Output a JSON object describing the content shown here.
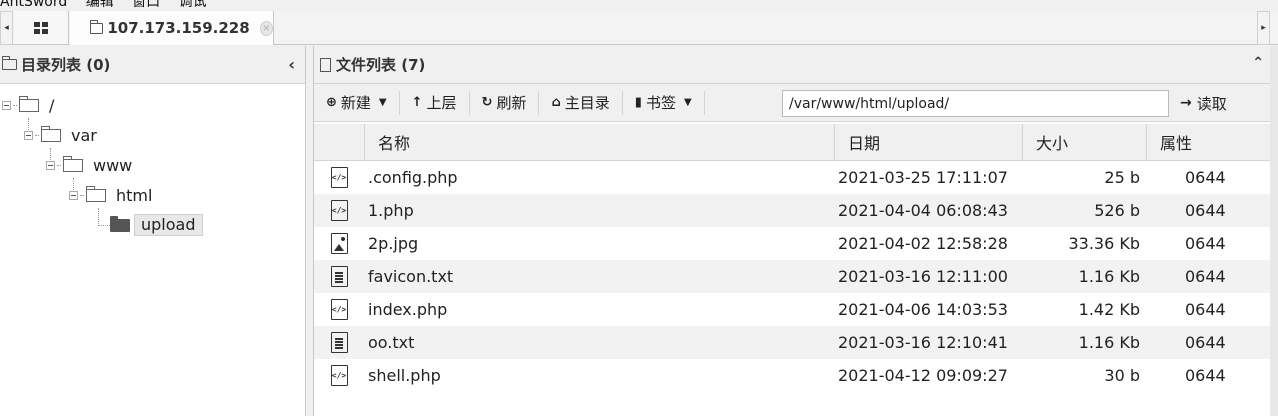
{
  "menubar": {
    "items": [
      "AntSword",
      "编辑",
      "窗口",
      "调试"
    ]
  },
  "tabs": {
    "home_icon": "grid-icon",
    "host_tab": {
      "label": "107.173.159.228",
      "icon": "folder-outline-icon",
      "close": "×"
    }
  },
  "left_panel": {
    "title": "目录列表 (0)",
    "collapse": "‹",
    "tree": {
      "root": "/",
      "var": "var",
      "www": "www",
      "html": "html",
      "upload": "upload"
    }
  },
  "right_panel": {
    "title": "文件列表 (7)",
    "expand": "⌃",
    "toolbar": {
      "new_label": "新建",
      "up_label": "上层",
      "refresh_label": "刷新",
      "home_label": "主目录",
      "bookmark_label": "书签",
      "path_value": "/var/www/html/upload/",
      "read_label": "读取"
    },
    "columns": {
      "name": "名称",
      "date": "日期",
      "size": "大小",
      "attr": "属性"
    },
    "files": [
      {
        "type": "code",
        "name": ".config.php",
        "date": "2021-03-25 17:11:07",
        "size": "25 b",
        "attr": "0644"
      },
      {
        "type": "code",
        "name": "1.php",
        "date": "2021-04-04 06:08:43",
        "size": "526 b",
        "attr": "0644"
      },
      {
        "type": "image",
        "name": "2p.jpg",
        "date": "2021-04-02 12:58:28",
        "size": "33.36 Kb",
        "attr": "0644"
      },
      {
        "type": "text",
        "name": "favicon.txt",
        "date": "2021-03-16 12:11:00",
        "size": "1.16 Kb",
        "attr": "0644"
      },
      {
        "type": "code",
        "name": "index.php",
        "date": "2021-04-06 14:03:53",
        "size": "1.42 Kb",
        "attr": "0644"
      },
      {
        "type": "text",
        "name": "oo.txt",
        "date": "2021-03-16 12:10:41",
        "size": "1.16 Kb",
        "attr": "0644"
      },
      {
        "type": "code",
        "name": "shell.php",
        "date": "2021-04-12 09:09:27",
        "size": "30 b",
        "attr": "0644"
      }
    ]
  }
}
